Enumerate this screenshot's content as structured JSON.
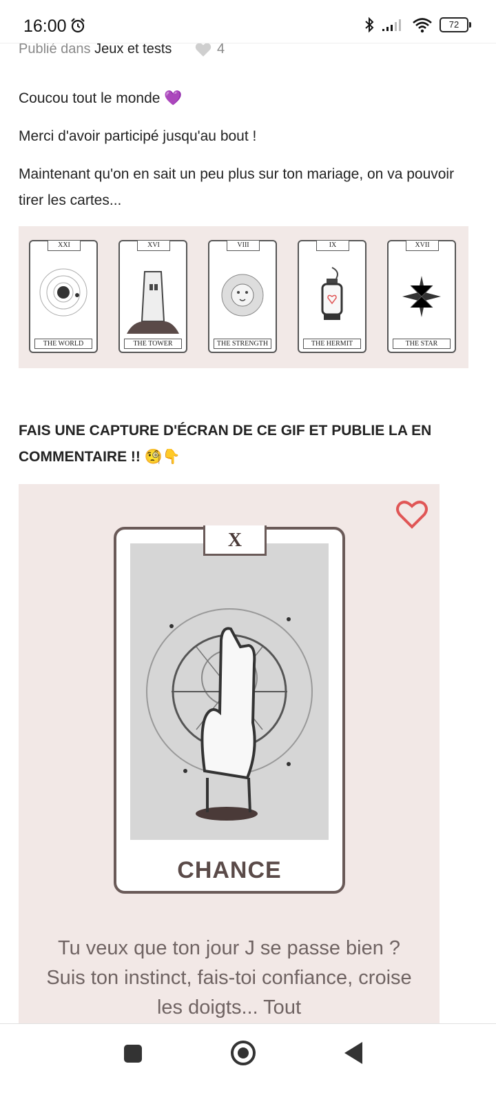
{
  "status_bar": {
    "time": "16:00",
    "battery": "72",
    "icons": [
      "alarm-icon",
      "bluetooth-icon",
      "signal-icon",
      "wifi-icon",
      "battery-icon"
    ]
  },
  "post": {
    "posted_prefix": "Publié dans",
    "category": "Jeux et tests",
    "likes": "4",
    "greeting": "Coucou tout le monde 💜",
    "thanks": "Merci d'avoir participé jusqu'au bout !",
    "intro": "Maintenant qu'on en sait un peu plus sur ton mariage, on va pouvoir tirer les cartes...",
    "cards": [
      {
        "numeral": "XXI",
        "name": "THE WORLD"
      },
      {
        "numeral": "XVI",
        "name": "THE TOWER"
      },
      {
        "numeral": "VIII",
        "name": "THE STRENGTH"
      },
      {
        "numeral": "IX",
        "name": "THE HERMIT"
      },
      {
        "numeral": "XVII",
        "name": "THE STAR"
      }
    ],
    "call_to_action": "FAIS UNE CAPTURE D'ÉCRAN DE CE GIF ET PUBLIE LA EN COMMENTAIRE !! 🧐👇",
    "gif": {
      "card_numeral": "X",
      "card_name": "CHANCE",
      "caption": "Tu veux que ton jour J se passe bien ? Suis ton instinct, fais-toi confiance, croise les doigts... Tout"
    }
  },
  "colors": {
    "panel_bg": "#f2e8e6",
    "accent_heart": "#e05656",
    "card_border": "#6a5a58"
  }
}
